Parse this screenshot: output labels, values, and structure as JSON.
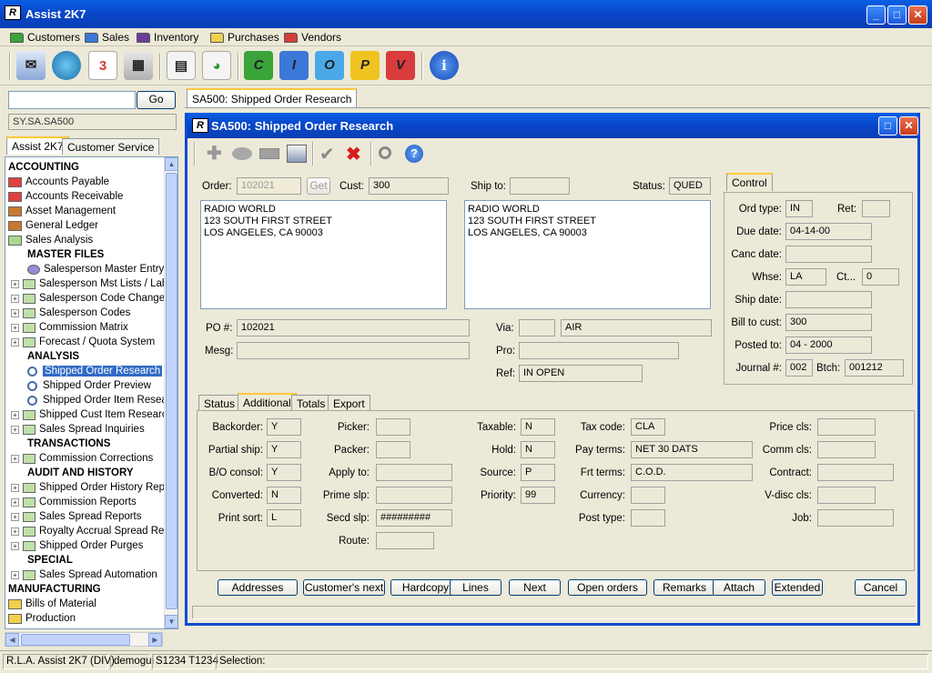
{
  "app": {
    "title": "Assist 2K7",
    "logo_text": "R"
  },
  "window_controls": {
    "minimize": "_",
    "maximize": "□",
    "close": "✕"
  },
  "menubar": [
    {
      "label": "Customers",
      "color": "#3aa43a"
    },
    {
      "label": "Sales",
      "color": "#3c78d8"
    },
    {
      "label": "Inventory",
      "color": "#6a3c9c"
    },
    {
      "label": "Purchases",
      "color": "#f0d04c"
    },
    {
      "label": "Vendors",
      "color": "#d83c3c"
    }
  ],
  "toolbar": {
    "letters": [
      "C",
      "I",
      "O",
      "P",
      "V"
    ],
    "letter_colors": [
      "#3aa43a",
      "#3c78d8",
      "#4aa8e8",
      "#f0c420",
      "#d83c3c"
    ],
    "calendar_number": "3",
    "info_glyph": "i"
  },
  "left": {
    "search_value": "",
    "go_label": "Go",
    "path": "SY.SA.SA500",
    "tabs": [
      "Assist 2K7",
      "Customer Service"
    ],
    "tree": [
      {
        "type": "head",
        "label": "ACCOUNTING"
      },
      {
        "type": "folder",
        "label": "Accounts Payable",
        "color": "#e04040"
      },
      {
        "type": "folder",
        "label": "Accounts Receivable",
        "color": "#e04040"
      },
      {
        "type": "folder",
        "label": "Asset Management",
        "color": "#c87830"
      },
      {
        "type": "folder",
        "label": "General Ledger",
        "color": "#c87830"
      },
      {
        "type": "folder",
        "label": "Sales Analysis",
        "color": "#a8d890"
      },
      {
        "type": "subhead",
        "label": "MASTER FILES"
      },
      {
        "type": "leaf",
        "label": "Salesperson Master Entry"
      },
      {
        "type": "plus",
        "label": "Salesperson Mst Lists / Lab"
      },
      {
        "type": "plus",
        "label": "Salesperson Code Change/"
      },
      {
        "type": "plus",
        "label": "Salesperson Codes"
      },
      {
        "type": "plus",
        "label": "Commission Matrix"
      },
      {
        "type": "plus",
        "label": "Forecast / Quota System"
      },
      {
        "type": "subhead",
        "label": "ANALYSIS"
      },
      {
        "type": "mag",
        "label": "Shipped Order Research",
        "selected": true
      },
      {
        "type": "mag",
        "label": "Shipped Order Preview"
      },
      {
        "type": "mag",
        "label": "Shipped Order Item Resear"
      },
      {
        "type": "plus",
        "label": "Shipped Cust Item Researc"
      },
      {
        "type": "plus",
        "label": "Sales Spread Inquiries"
      },
      {
        "type": "subhead",
        "label": "TRANSACTIONS"
      },
      {
        "type": "plus",
        "label": "Commission Corrections"
      },
      {
        "type": "subhead",
        "label": "AUDIT AND HISTORY"
      },
      {
        "type": "plus",
        "label": "Shipped Order History Rep"
      },
      {
        "type": "plus",
        "label": "Commission Reports"
      },
      {
        "type": "plus",
        "label": "Sales Spread Reports"
      },
      {
        "type": "plus",
        "label": "Royalty Accrual Spread Re"
      },
      {
        "type": "plus",
        "label": "Shipped Order Purges"
      },
      {
        "type": "subhead",
        "label": "SPECIAL"
      },
      {
        "type": "plus",
        "label": "Sales Spread Automation"
      },
      {
        "type": "head",
        "label": "MANUFACTURING"
      },
      {
        "type": "folder",
        "label": "Bills of Material",
        "color": "#f0d04c"
      },
      {
        "type": "folder",
        "label": "Production",
        "color": "#f0d04c"
      }
    ]
  },
  "doc_tab": "SA500: Shipped Order Research",
  "form": {
    "title": "SA500: Shipped Order Research",
    "order_label": "Order:",
    "order_value": "102021",
    "get_label": "Get",
    "cust_label": "Cust:",
    "cust_value": "300",
    "shipto_label": "Ship to:",
    "shipto_value": "",
    "status_label": "Status:",
    "status_value": "QUED",
    "bill_address": "RADIO WORLD\n123 SOUTH FIRST STREET\nLOS ANGELES, CA 90003",
    "ship_address": "RADIO WORLD\n123 SOUTH FIRST STREET\nLOS ANGELES, CA 90003",
    "po_label": "PO #:",
    "po_value": "102021",
    "mesg_label": "Mesg:",
    "mesg_value": "",
    "via_label": "Via:",
    "via_code": "",
    "via_value": "AIR",
    "pro_label": "Pro:",
    "pro_value": "",
    "ref_label": "Ref:",
    "ref_value": "IN OPEN",
    "control": {
      "tab": "Control",
      "ordtype_label": "Ord type:",
      "ordtype_value": "IN",
      "ret_label": "Ret:",
      "ret_value": "",
      "duedate_label": "Due date:",
      "duedate_value": "04-14-00",
      "canc_label": "Canc date:",
      "canc_value": "",
      "whse_label": "Whse:",
      "whse_value": "LA",
      "ct_label": "Ct...",
      "ct_value": "0",
      "shipdate_label": "Ship date:",
      "shipdate_value": "",
      "billto_label": "Bill to cust:",
      "billto_value": "300",
      "posted_label": "Posted to:",
      "posted_value": "04 - 2000",
      "journal_label": "Journal #:",
      "journal_value": "002",
      "btch_label": "Btch:",
      "btch_value": "001212"
    },
    "tabs": [
      "Status",
      "Additional",
      "Totals",
      "Export"
    ],
    "additional": {
      "col1": [
        {
          "label": "Backorder:",
          "value": "Y"
        },
        {
          "label": "Partial ship:",
          "value": "Y"
        },
        {
          "label": "B/O consol:",
          "value": "Y"
        },
        {
          "label": "Converted:",
          "value": "N"
        },
        {
          "label": "Print sort:",
          "value": "L"
        }
      ],
      "col2": [
        {
          "label": "Picker:",
          "value": ""
        },
        {
          "label": "Packer:",
          "value": ""
        },
        {
          "label": "Apply to:",
          "value": ""
        },
        {
          "label": "Prime slp:",
          "value": ""
        },
        {
          "label": "Secd slp:",
          "value": "#########"
        },
        {
          "label": "Route:",
          "value": ""
        }
      ],
      "col3": [
        {
          "label": "Taxable:",
          "value": "N"
        },
        {
          "label": "Hold:",
          "value": "N"
        },
        {
          "label": "Source:",
          "value": "P"
        },
        {
          "label": "Priority:",
          "value": "99"
        }
      ],
      "col4": [
        {
          "label": "Tax code:",
          "value": "CLA"
        },
        {
          "label": "Pay terms:",
          "value": "NET 30 DATS"
        },
        {
          "label": "Frt terms:",
          "value": "C.O.D."
        },
        {
          "label": "Currency:",
          "value": ""
        },
        {
          "label": "Post type:",
          "value": ""
        }
      ],
      "col5": [
        {
          "label": "Price cls:",
          "value": ""
        },
        {
          "label": "Comm cls:",
          "value": ""
        },
        {
          "label": "Contract:",
          "value": ""
        },
        {
          "label": "V-disc cls:",
          "value": ""
        },
        {
          "label": "Job:",
          "value": ""
        }
      ]
    },
    "buttons": [
      "Addresses",
      "Customer's next",
      "Hardcopy",
      "Lines",
      "Next",
      "Open orders",
      "Remarks",
      "Attach",
      "Extended",
      "Cancel"
    ]
  },
  "status": {
    "company": "R.L.A. Assist 2K7 (DIV)",
    "user": "demogui",
    "terminal": "S1234 T1234",
    "selection": "Selection:"
  }
}
